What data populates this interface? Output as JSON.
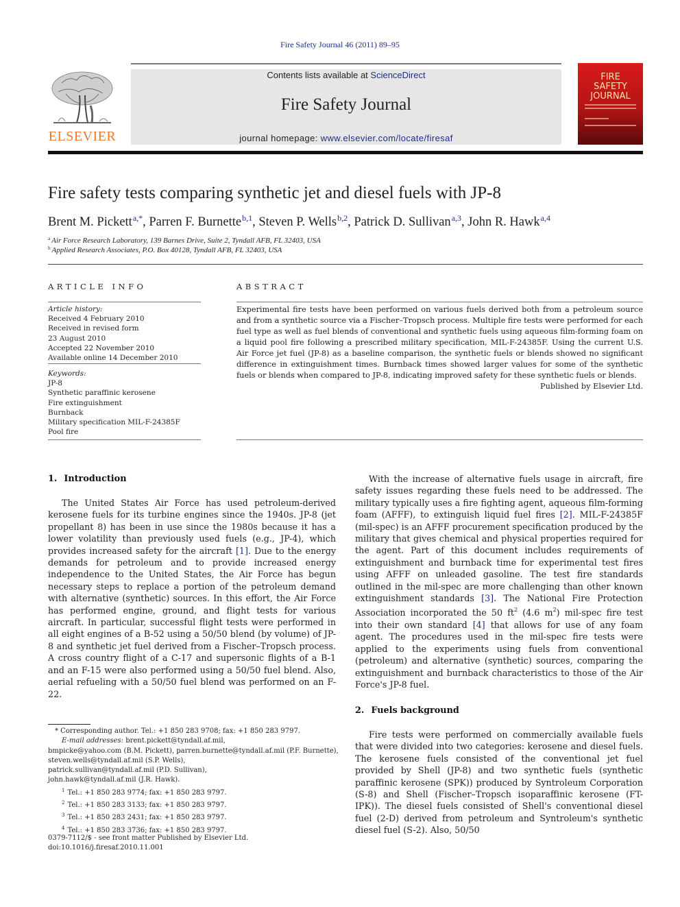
{
  "header": {
    "citation": "Fire Safety Journal 46 (2011) 89–95",
    "contents_prefix": "Contents lists available at ",
    "contents_link": "ScienceDirect",
    "journal_name": "Fire Safety Journal",
    "homepage_prefix": "journal homepage: ",
    "homepage_link": "www.elsevier.com/locate/firesaf",
    "publisher_logo": "ELSEVIER",
    "cover": {
      "line1": "FIRE",
      "line2": "SAFETY",
      "line3": "JOURNAL"
    },
    "colors": {
      "link": "#1f2d8a",
      "elsevier_orange": "#e9792b",
      "cover_red": "#d81a1a"
    }
  },
  "article": {
    "title": "Fire safety tests comparing synthetic jet and diesel fuels with JP-8",
    "authors": [
      {
        "name": "Brent M. Pickett",
        "sup": "a,*",
        "sep": ", "
      },
      {
        "name": "Parren F. Burnette",
        "sup": "b,1",
        "sep": ", "
      },
      {
        "name": "Steven P. Wells",
        "sup": "b,2",
        "sep": ", "
      },
      {
        "name": "Patrick D. Sullivan",
        "sup": "a,3",
        "sep": ", "
      },
      {
        "name": "John R. Hawk",
        "sup": "a,4",
        "sep": ""
      }
    ],
    "affiliations": [
      {
        "mark": "a",
        "text": "Air Force Research Laboratory, 139 Barnes Drive, Suite 2, Tyndall AFB, FL 32403, USA"
      },
      {
        "mark": "b",
        "text": "Applied Research Associates, P.O. Box 40128, Tyndall AFB, FL 32403, USA"
      }
    ]
  },
  "article_info": {
    "heading": "ARTICLE INFO",
    "history_label": "Article history:",
    "history": [
      "Received 4 February 2010",
      "Received in revised form",
      "23 August 2010",
      "Accepted 22 November 2010",
      "Available online 14 December 2010"
    ],
    "keywords_label": "Keywords:",
    "keywords": [
      "JP-8",
      "Synthetic paraffinic kerosene",
      "Fire extinguishment",
      "Burnback",
      "Military specification MIL-F-24385F",
      "Pool fire"
    ]
  },
  "abstract": {
    "heading": "ABSTRACT",
    "text": "Experimental fire tests have been performed on various fuels derived both from a petroleum source and from a synthetic source via a Fischer–Tropsch process. Multiple fire tests were performed for each fuel type as well as fuel blends of conventional and synthetic fuels using aqueous film-forming foam on a liquid pool fire following a prescribed military specification, MIL-F-24385F. Using the current U.S. Air Force jet fuel (JP-8) as a baseline comparison, the synthetic fuels or blends showed no significant difference in extinguishment times. Burnback times showed larger values for some of the synthetic fuels or blends when compared to JP-8, indicating improved safety for these synthetic fuels or blends.",
    "publisher_note": "Published by Elsevier Ltd."
  },
  "sections": {
    "intro": {
      "number": "1.",
      "title": "Introduction",
      "p1_a": "The United States Air Force has used petroleum-derived kerosene fuels for its turbine engines since the 1940s. JP-8 (jet propellant 8) has been in use since the 1980s because it has a lower volatility than previously used fuels (e.g., JP-4), which provides increased safety for the aircraft ",
      "p1_ref": "[1]",
      "p1_b": ". Due to the energy demands for petroleum and to provide increased energy independence to the United States, the Air Force has begun necessary steps to replace a portion of the petroleum demand with alternative (synthetic) sources. In this effort, the Air Force has performed engine, ground, and flight tests for various aircraft. In particular, successful flight tests were performed in all eight engines of a B-52 using a 50/50 blend (by volume) of JP-8 and synthetic jet fuel derived from a Fischer–Tropsch process. A cross country flight of a C-17 and supersonic flights of a B-1 and an F-15 were also performed using a 50/50 fuel blend. Also, aerial refueling with a 50/50 fuel blend was performed on an F-22.",
      "p2_a": "With the increase of alternative fuels usage in aircraft, fire safety issues regarding these fuels need to be addressed. The military typically uses a fire fighting agent, aqueous film-forming foam (AFFF), to extinguish liquid fuel fires ",
      "p2_ref1": "[2]",
      "p2_b": ". MIL-F-24385F (mil-spec) is an AFFF procurement specification produced by the military that gives chemical and physical properties required for the agent. Part of this document includes requirements of extinguishment and burnback time for experimental test fires using AFFF on unleaded gasoline. The test fire standards outlined in the mil-spec are more challenging than other known extinguishment standards ",
      "p2_ref2": "[3]",
      "p2_c": ". The National Fire Protection Association incorporated the 50 ft",
      "p2_sup1": "2",
      "p2_d": " (4.6 m",
      "p2_sup2": "2",
      "p2_e": ") mil-spec fire test into their own standard ",
      "p2_ref3": "[4]",
      "p2_f": " that allows for use of any foam agent. The procedures used in the mil-spec fire tests were applied to the experiments using fuels from conventional (petroleum) and alternative (synthetic) sources, comparing the extinguishment and burnback characteristics to those of the Air Force's JP-8 fuel."
    },
    "fuels": {
      "number": "2.",
      "title": "Fuels background",
      "p1": "Fire tests were performed on commercially available fuels that were divided into two categories: kerosene and diesel fuels. The kerosene fuels consisted of the conventional jet fuel provided by Shell (JP-8) and two synthetic fuels (synthetic paraffinic kerosene (SPK)) produced by Syntroleum Corporation (S-8) and Shell (Fischer–Tropsch isoparaffinic kerosene (FT-IPK)). The diesel fuels consisted of Shell's conventional diesel fuel (2-D) derived from petroleum and Syntroleum's synthetic diesel fuel (S-2). Also, 50/50"
    }
  },
  "footnotes": {
    "corresponding": "* Corresponding author. Tel.: +1 850 283 9708; fax: +1 850 283 9797.",
    "email_label": "E-mail addresses:",
    "email_line1": " brent.pickett@tyndall.af.mil,",
    "email_line2": "bmpicke@yahoo.com (B.M. Pickett), parren.burnette@tyndall.af.mil (P.F. Burnette),",
    "email_line3": "steven.wells@tyndall.af.mil (S.P. Wells),",
    "email_line4": "patrick.sullivan@tyndall.af.mil (P.D. Sullivan),",
    "email_line5": "john.hawk@tyndall.af.mil (J.R. Hawk).",
    "notes": [
      {
        "mark": "1",
        "text": "Tel.: +1 850 283 9774; fax: +1 850 283 9797."
      },
      {
        "mark": "2",
        "text": "Tel.: +1 850 283 3133; fax: +1 850 283 9797."
      },
      {
        "mark": "3",
        "text": "Tel.: +1 850 283 2431; fax: +1 850 283 9797."
      },
      {
        "mark": "4",
        "text": "Tel.: +1 850 283 3736; fax: +1 850 283 9797."
      }
    ],
    "front_matter": "0379-7112/$ - see front matter Published by Elsevier Ltd.",
    "doi": "doi:10.1016/j.firesaf.2010.11.001"
  }
}
